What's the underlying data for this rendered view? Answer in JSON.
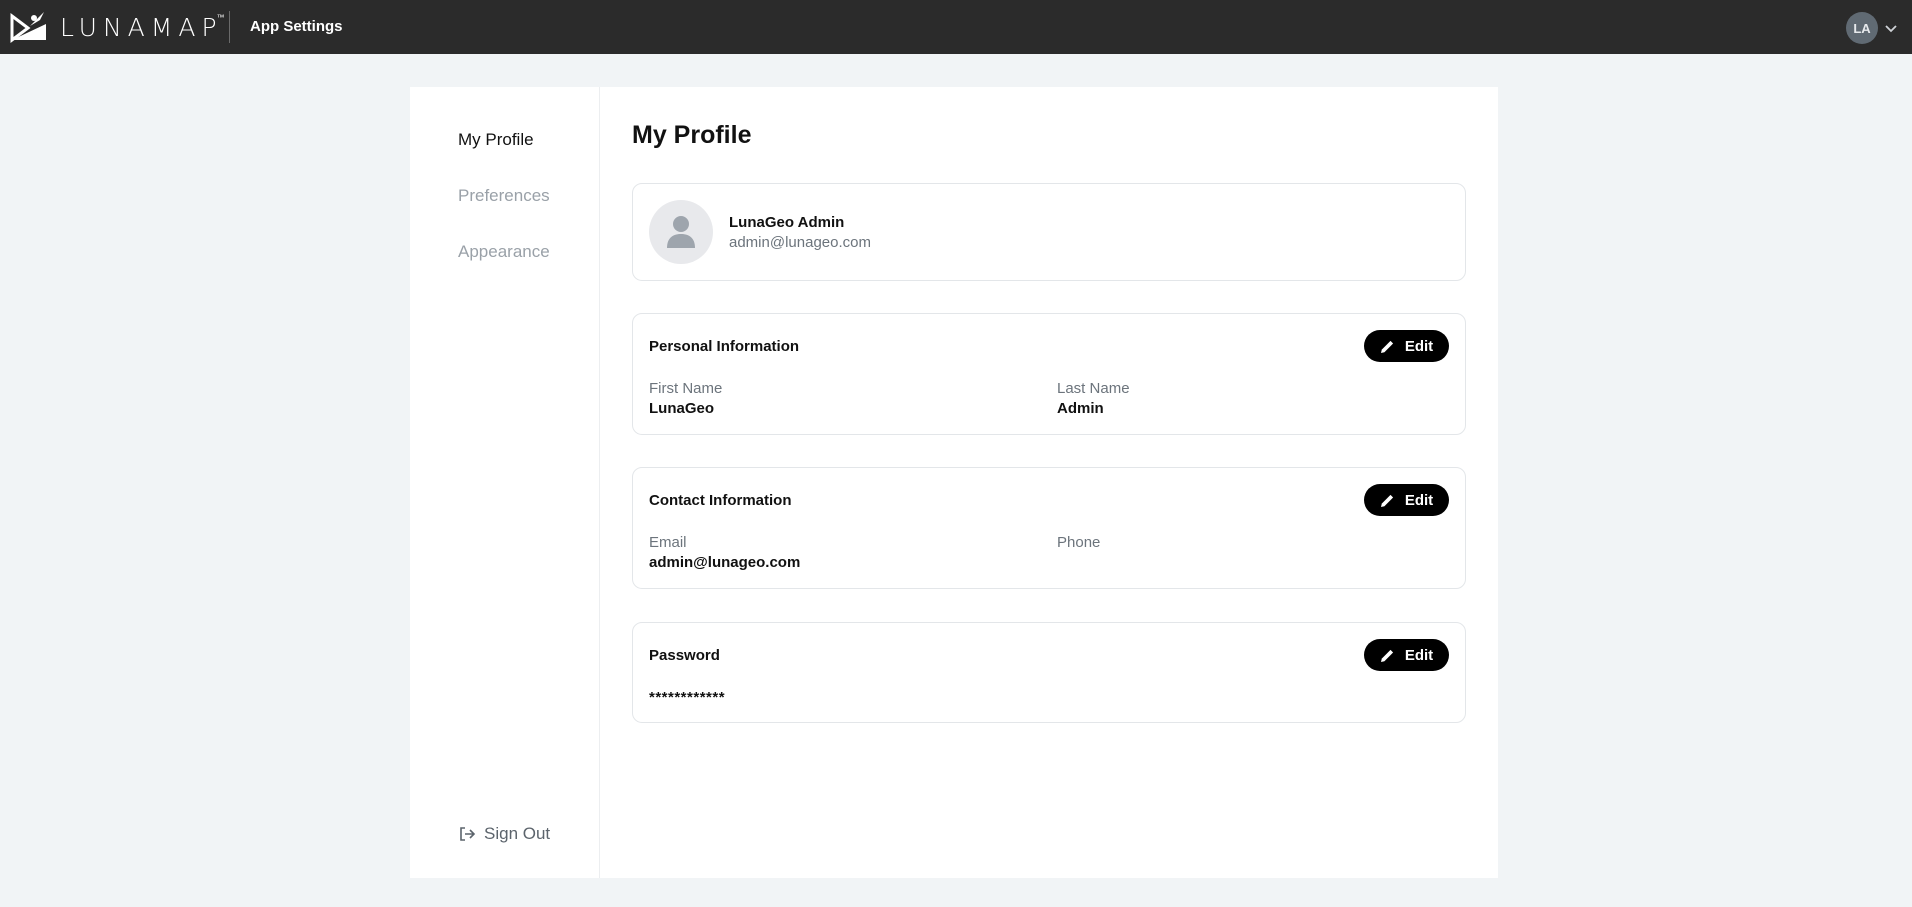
{
  "header": {
    "brand": "LUNAMAP",
    "brand_tm": "™",
    "app_title": "App Settings",
    "user_initials": "LA"
  },
  "sidebar": {
    "items": [
      {
        "label": "My Profile",
        "active": true
      },
      {
        "label": "Preferences",
        "active": false
      },
      {
        "label": "Appearance",
        "active": false
      }
    ],
    "sign_out": "Sign Out"
  },
  "main": {
    "title": "My Profile",
    "profile": {
      "name": "LunaGeo Admin",
      "email": "admin@lunageo.com"
    },
    "personal": {
      "title": "Personal Information",
      "edit_label": "Edit",
      "first_name_label": "First Name",
      "first_name_value": "LunaGeo",
      "last_name_label": "Last Name",
      "last_name_value": "Admin"
    },
    "contact": {
      "title": "Contact Information",
      "edit_label": "Edit",
      "email_label": "Email",
      "email_value": "admin@lunageo.com",
      "phone_label": "Phone",
      "phone_value": ""
    },
    "password": {
      "title": "Password",
      "edit_label": "Edit",
      "value": "************"
    }
  },
  "icons": {
    "logo": "lunamap-logo-icon",
    "chevron": "chevron-down-icon",
    "avatar": "user-silhouette-icon",
    "edit": "pencil-icon",
    "sign_out": "sign-out-icon"
  },
  "colors": {
    "topbar": "#2b2b2b",
    "background": "#f1f4f6",
    "button": "#000000",
    "muted_text": "#6c747c",
    "inactive_nav": "#9aa1a8"
  }
}
